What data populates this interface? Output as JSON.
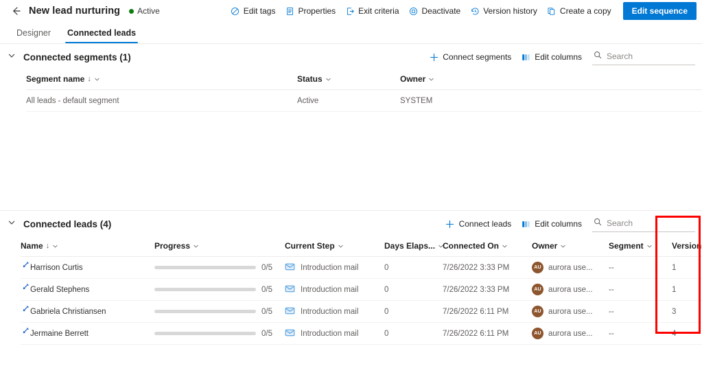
{
  "header": {
    "back_icon": "arrow-left-icon",
    "title": "New lead nurturing",
    "status": "Active",
    "status_color": "#107c10",
    "accent_color": "#0078d4",
    "actions": [
      {
        "label": "Edit tags",
        "icon": "tag-icon"
      },
      {
        "label": "Properties",
        "icon": "document-properties-icon"
      },
      {
        "label": "Exit criteria",
        "icon": "exit-icon"
      },
      {
        "label": "Deactivate",
        "icon": "stop-circle-icon"
      },
      {
        "label": "Version history",
        "icon": "history-icon"
      },
      {
        "label": "Create a copy",
        "icon": "copy-icon"
      }
    ],
    "primary_button": "Edit sequence"
  },
  "tabs": [
    {
      "label": "Designer",
      "active": false
    },
    {
      "label": "Connected leads",
      "active": true
    }
  ],
  "segments_section": {
    "title": "Connected segments (1)",
    "collapse_icon": "chevron-down-icon",
    "actions": [
      {
        "label": "Connect segments",
        "icon": "plus-icon"
      },
      {
        "label": "Edit columns",
        "icon": "edit-columns-icon"
      }
    ],
    "search_placeholder": "Search",
    "search_value": "",
    "columns": [
      {
        "label": "Segment name",
        "sorted": true,
        "sort_dir": "↓"
      },
      {
        "label": "Status",
        "sorted": false
      },
      {
        "label": "Owner",
        "sorted": false
      }
    ],
    "rows": [
      {
        "segment_name": "All leads - default segment",
        "status": "Active",
        "owner": "SYSTEM"
      }
    ]
  },
  "leads_section": {
    "title": "Connected leads (4)",
    "collapse_icon": "chevron-down-icon",
    "actions": [
      {
        "label": "Connect leads",
        "icon": "plus-icon"
      },
      {
        "label": "Edit columns",
        "icon": "edit-columns-icon"
      }
    ],
    "search_placeholder": "Search",
    "search_value": "",
    "columns": [
      {
        "label": "Name",
        "sorted": true,
        "sort_dir": "↓"
      },
      {
        "label": "Progress",
        "sorted": false
      },
      {
        "label": "Current Step",
        "sorted": false
      },
      {
        "label": "Days Elaps...",
        "sorted": false
      },
      {
        "label": "Connected On",
        "sorted": false
      },
      {
        "label": "Owner",
        "sorted": false
      },
      {
        "label": "Segment",
        "sorted": false
      },
      {
        "label": "Version",
        "sorted": false
      }
    ],
    "rows": [
      {
        "name": "Harrison Curtis",
        "progress_label": "0/5",
        "progress_pct": 0,
        "current_step": "Introduction mail",
        "days_elapsed": "0",
        "connected_on": "7/26/2022 3:33 PM",
        "owner": "aurora use...",
        "owner_initials": "AU",
        "segment": "--",
        "version": "1"
      },
      {
        "name": "Gerald Stephens",
        "progress_label": "0/5",
        "progress_pct": 0,
        "current_step": "Introduction mail",
        "days_elapsed": "0",
        "connected_on": "7/26/2022 3:33 PM",
        "owner": "aurora use...",
        "owner_initials": "AU",
        "segment": "--",
        "version": "1"
      },
      {
        "name": "Gabriela Christiansen",
        "progress_label": "0/5",
        "progress_pct": 0,
        "current_step": "Introduction mail",
        "days_elapsed": "0",
        "connected_on": "7/26/2022 6:11 PM",
        "owner": "aurora use...",
        "owner_initials": "AU",
        "segment": "--",
        "version": "3"
      },
      {
        "name": "Jermaine Berrett",
        "progress_label": "0/5",
        "progress_pct": 0,
        "current_step": "Introduction mail",
        "days_elapsed": "0",
        "connected_on": "7/26/2022 6:11 PM",
        "owner": "aurora use...",
        "owner_initials": "AU",
        "segment": "--",
        "version": "4"
      }
    ]
  },
  "annotation": {
    "type": "red-rectangle-highlight",
    "target_column": "Version",
    "color": "#ff0000"
  }
}
